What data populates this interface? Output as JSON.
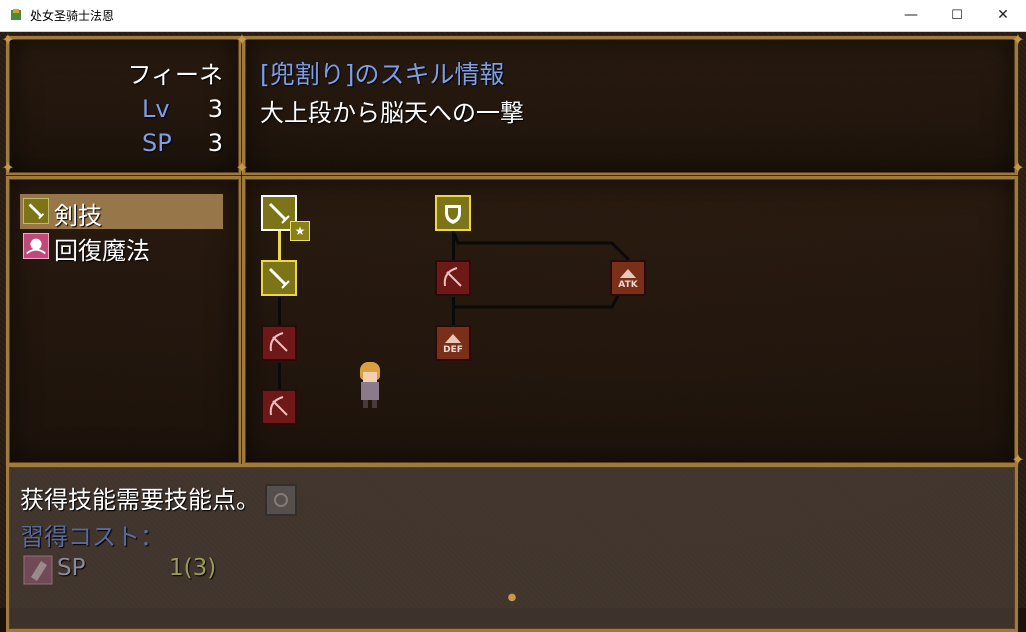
{
  "window": {
    "title": "处女圣骑士法恩",
    "controls": {
      "minimize": "—",
      "maximize": "☐",
      "close": "✕"
    }
  },
  "actor": {
    "name": "フィーネ",
    "lv_label": "Lv",
    "lv_value": "3",
    "sp_label": "SP",
    "sp_value": "3"
  },
  "skill_info": {
    "title": "[兜割り]のスキル情報",
    "description": "大上段から脳天への一撃"
  },
  "categories": [
    {
      "label": "剣技",
      "icon": "sword-icon",
      "selected": true
    },
    {
      "label": "回復魔法",
      "icon": "heal-magic-icon",
      "selected": false
    }
  ],
  "skill_tree": {
    "nodes": [
      {
        "icon": "sword-icon",
        "state": "learned-selected",
        "badge": "★"
      },
      {
        "icon": "shield-icon",
        "state": "available"
      },
      {
        "icon": "sword-icon",
        "state": "available"
      },
      {
        "icon": "bow-locked-icon",
        "state": "locked"
      },
      {
        "icon": "atk-up-icon",
        "state": "locked",
        "text": "ATK"
      },
      {
        "icon": "bow-locked-icon",
        "state": "locked"
      },
      {
        "icon": "def-up-icon",
        "state": "locked",
        "text": "DEF"
      },
      {
        "icon": "bow-locked-icon",
        "state": "locked"
      },
      {
        "icon": "hidden-icon",
        "state": "hidden"
      }
    ],
    "colors": {
      "learned": "#7a7418",
      "available_border": "#e8d84a",
      "locked": "#7a1a1a",
      "stat": "#8a3a20",
      "line_active": "#e8d84a",
      "line_inactive": "#0a0a0a"
    }
  },
  "message": {
    "text": "获得技能需要技能点。",
    "cost_label": "習得コスト：",
    "cost_icon": "scroll-icon",
    "cost_type": "SP",
    "cost_value": "1(3)"
  }
}
